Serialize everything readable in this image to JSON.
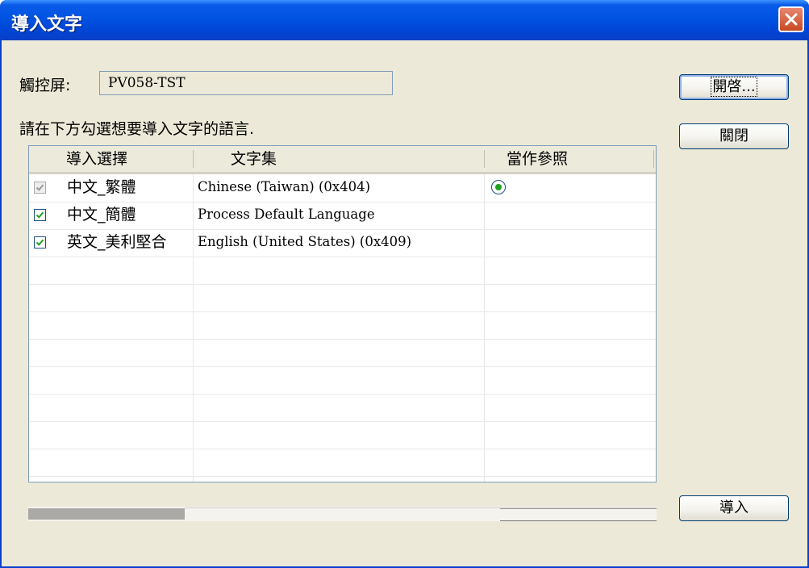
{
  "window": {
    "title": "導入文字"
  },
  "form": {
    "screen_label": "觸控屏:",
    "screen_value": "PV058-TST",
    "instruction": "請在下方勾選想要導入文字的語言."
  },
  "buttons": {
    "open": "開啓...",
    "close": "關閉",
    "import": "導入"
  },
  "table": {
    "headers": [
      "導入選擇",
      "文字集",
      "當作參照"
    ],
    "rows": [
      {
        "checked": true,
        "disabled": true,
        "language": "中文_繁體",
        "charset": "Chinese (Taiwan) (0x404)",
        "reference": true
      },
      {
        "checked": true,
        "disabled": false,
        "language": "中文_簡體",
        "charset": "Process Default Language",
        "reference": false
      },
      {
        "checked": true,
        "disabled": false,
        "language": "英文_美利堅合",
        "charset": "English (United States) (0x409)",
        "reference": false
      }
    ]
  },
  "colors": {
    "titlebar": "#0053e1",
    "dialog_bg": "#ece9d8",
    "check": "#21a121"
  },
  "icons": {
    "close": "close-icon",
    "check": "checkmark-icon",
    "radio": "radio-selected-icon"
  }
}
